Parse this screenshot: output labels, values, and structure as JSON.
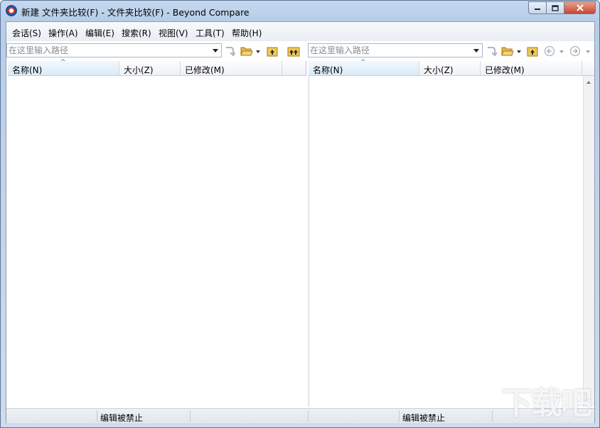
{
  "window": {
    "title": "新建 文件夹比较(F) - 文件夹比较(F) - Beyond Compare",
    "controls": {
      "minimize_icon": "minimize-icon",
      "maximize_icon": "maximize-icon",
      "close_icon": "close-icon"
    }
  },
  "menu": {
    "items": [
      "会话(S)",
      "操作(A)",
      "编辑(E)",
      "搜索(R)",
      "视图(V)",
      "工具(T)",
      "帮助(H)"
    ]
  },
  "left": {
    "path_placeholder": "在这里输入路径",
    "columns": {
      "name": "名称(N)",
      "size": "大小(Z)",
      "modified": "已修改(M)"
    },
    "status": "编辑被禁止"
  },
  "right": {
    "path_placeholder": "在这里输入路径",
    "columns": {
      "name": "名称(N)",
      "size": "大小(Z)",
      "modified": "已修改(M)"
    },
    "status": "编辑被禁止"
  },
  "watermark": {
    "text": "下载吧"
  },
  "colors": {
    "title_bar": "#b7cde8",
    "close_button": "#c9462d",
    "sorted_column": "#d9ebf8",
    "folder": "#e8b84a"
  }
}
